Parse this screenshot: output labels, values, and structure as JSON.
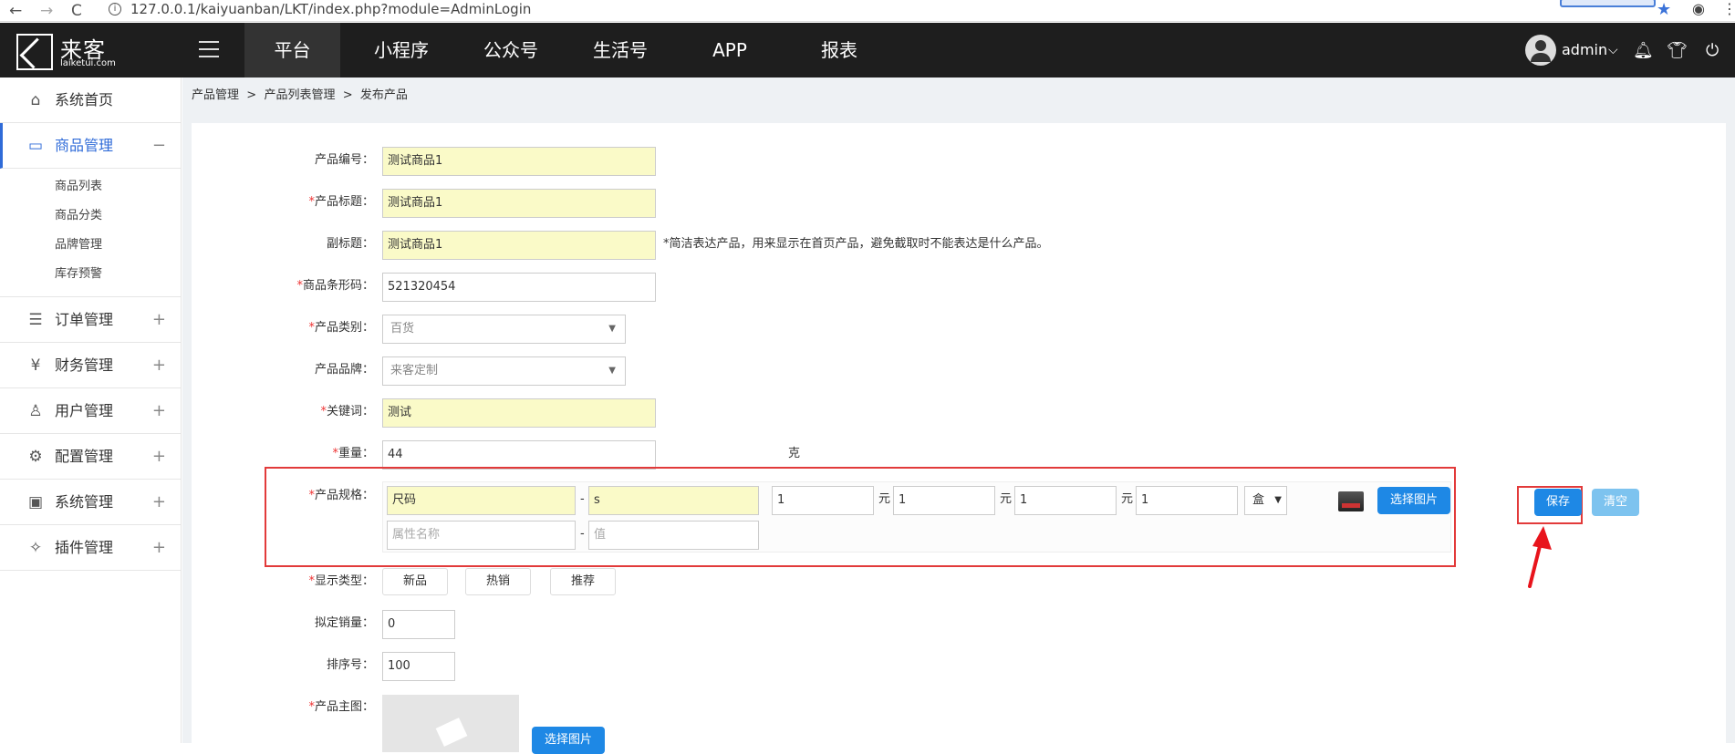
{
  "browser": {
    "url": "127.0.0.1/kaiyuanban/LKT/index.php?module=AdminLogin"
  },
  "header": {
    "logo_cn": "来客",
    "logo_en": "laiketui.com",
    "nav": [
      "平台",
      "小程序",
      "公众号",
      "生活号",
      "APP",
      "报表"
    ],
    "active_nav": "平台",
    "user": "admin"
  },
  "sidebar": {
    "items": [
      {
        "label": "系统首页",
        "icon": "home-icon"
      },
      {
        "label": "商品管理",
        "icon": "briefcase-icon",
        "toggle": "−"
      },
      {
        "label": "订单管理",
        "icon": "clipboard-icon",
        "toggle": "+"
      },
      {
        "label": "财务管理",
        "icon": "yen-icon",
        "toggle": "+"
      },
      {
        "label": "用户管理",
        "icon": "user-icon",
        "toggle": "+"
      },
      {
        "label": "配置管理",
        "icon": "config-icon",
        "toggle": "+"
      },
      {
        "label": "系统管理",
        "icon": "monitor-icon",
        "toggle": "+"
      },
      {
        "label": "插件管理",
        "icon": "puzzle-icon",
        "toggle": "+"
      }
    ],
    "sub_items": [
      "商品列表",
      "商品分类",
      "品牌管理",
      "库存预警"
    ]
  },
  "breadcrumb": {
    "a": "产品管理",
    "b": "产品列表管理",
    "c": "发布产品",
    "sep": ">"
  },
  "form": {
    "product_code": {
      "label": "产品编号：",
      "value": "测试商品1"
    },
    "product_title": {
      "label": "产品标题：",
      "value": "测试商品1"
    },
    "subtitle": {
      "label": "副标题：",
      "value": "测试商品1",
      "hint": "*简洁表达产品，用来显示在首页产品，避免截取时不能表达是什么产品。"
    },
    "barcode": {
      "label": "商品条形码：",
      "value": "521320454"
    },
    "category": {
      "label": "产品类别：",
      "value": "百货"
    },
    "brand": {
      "label": "产品品牌：",
      "value": "来客定制"
    },
    "keyword": {
      "label": "关键词：",
      "value": "测试"
    },
    "weight": {
      "label": "重量：",
      "value": "44",
      "unit": "克"
    },
    "spec": {
      "label": "产品规格：",
      "attr_name": "尺码",
      "attr_value": "s",
      "attr_name_placeholder": "属性名称",
      "attr_value_placeholder": "值",
      "dash": "-",
      "prices": [
        "1",
        "1",
        "1",
        "1"
      ],
      "yuan": "元",
      "unit": "盒",
      "choose_image": "选择图片",
      "save": "保存",
      "clear": "清空"
    },
    "display_type": {
      "label": "显示类型：",
      "options": [
        "新品",
        "热销",
        "推荐"
      ]
    },
    "planned_sales": {
      "label": "拟定销量：",
      "value": "0"
    },
    "sort": {
      "label": "排序号：",
      "value": "100"
    },
    "main_image": {
      "label": "产品主图：",
      "button": "选择图片"
    }
  }
}
